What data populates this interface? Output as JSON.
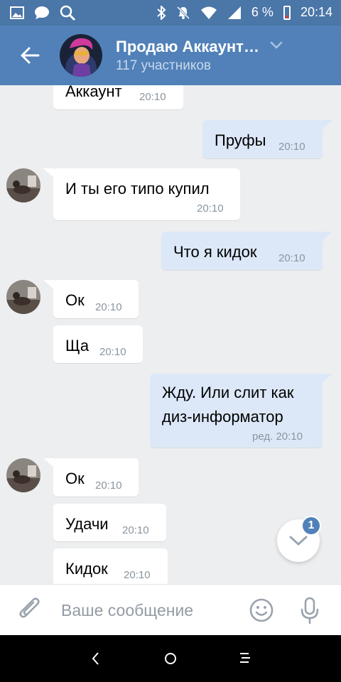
{
  "status_bar": {
    "icons_left": [
      "image-icon",
      "message-icon",
      "search-icon"
    ],
    "icons_right": [
      "bluetooth-icon",
      "mute-icon",
      "wifi-icon",
      "signal-icon"
    ],
    "battery": "6 %",
    "time": "20:14"
  },
  "header": {
    "title": "Продаю Аккаунт…",
    "subtitle": "117 участников",
    "back_icon": "arrow-left-icon",
    "chevron_icon": "chevron-down-icon"
  },
  "messages": [
    {
      "dir": "in",
      "text": "Аккаунт",
      "time": "20:10",
      "avatar": false
    },
    {
      "dir": "out",
      "text": "Пруфы",
      "time": "20:10"
    },
    {
      "dir": "in",
      "text": "И ты его типо купил",
      "time": "20:10",
      "avatar": true
    },
    {
      "dir": "out",
      "text": "Что я кидок",
      "time": "20:10"
    },
    {
      "dir": "in",
      "text": "Ок",
      "time": "20:10",
      "avatar": true
    },
    {
      "dir": "in",
      "text": "Ща",
      "time": "20:10",
      "avatar": false
    },
    {
      "dir": "out",
      "text_line1": "Жду. Или слит как",
      "text_line2": "диз-информатор",
      "time": "ред. 20:10"
    },
    {
      "dir": "in",
      "text": "Ок",
      "time": "20:10",
      "avatar": true
    },
    {
      "dir": "in",
      "text": "Удачи",
      "time": "20:10",
      "avatar": false
    },
    {
      "dir": "in",
      "text": "Кидок",
      "time": "20:10",
      "avatar": false
    }
  ],
  "scroll_button": {
    "icon": "chevron-down-icon",
    "badge": "1"
  },
  "composer": {
    "placeholder": "Ваше сообщение",
    "attach_icon": "paperclip-icon",
    "emoji_icon": "smile-icon",
    "mic_icon": "microphone-icon"
  },
  "colors": {
    "status_bar": "#4a76a8",
    "header": "#5181b8",
    "background": "#edeef0",
    "outgoing_bubble": "#dce8f7",
    "incoming_bubble": "#ffffff"
  }
}
